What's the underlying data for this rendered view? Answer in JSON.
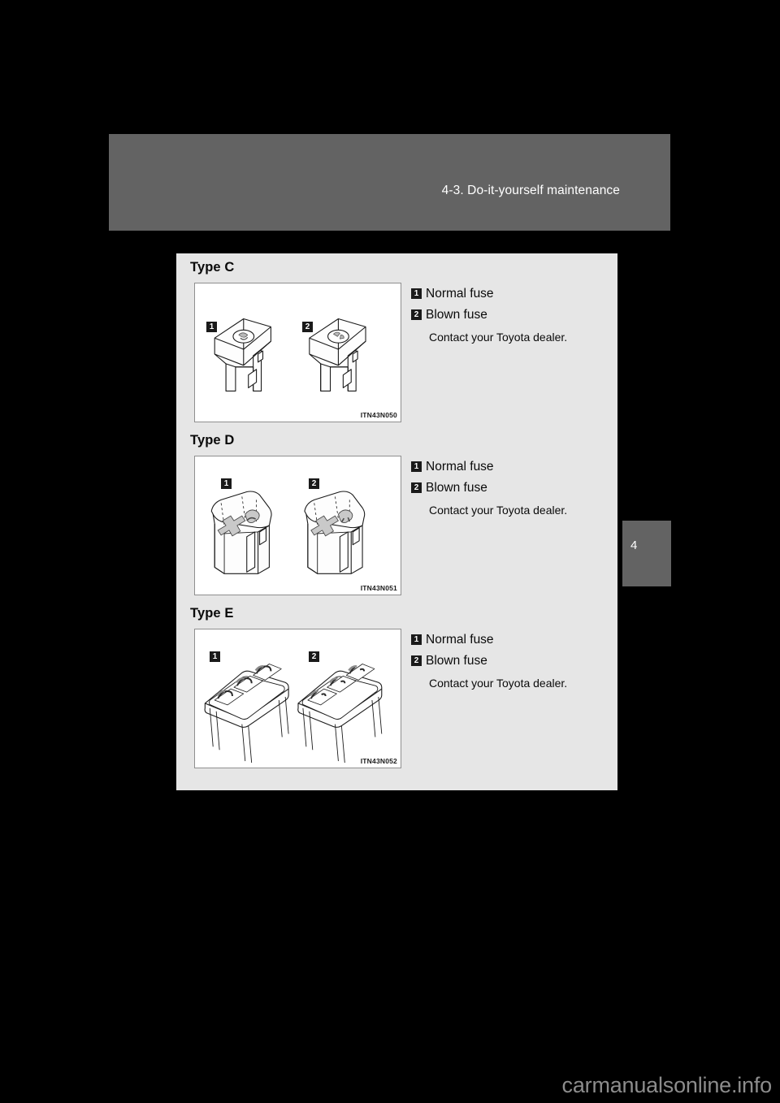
{
  "page": {
    "header_title": "4-3. Do-it-yourself maintenance",
    "chapter_tab_number": "4",
    "watermark": "carmanualsonline.info",
    "colors": {
      "background": "#000000",
      "header_band": "#636363",
      "panel": "#e6e6e6",
      "figure_bg": "#ffffff",
      "marker": "#1a1a1a",
      "text": "#0a0a0a"
    }
  },
  "sections": [
    {
      "heading": "Type C",
      "figure_code": "ITN43N050",
      "figure_marker_1": "1",
      "figure_marker_2": "2",
      "callouts": [
        {
          "marker": "1",
          "label": "Normal fuse"
        },
        {
          "marker": "2",
          "label": "Blown fuse"
        }
      ],
      "note": "Contact your Toyota dealer."
    },
    {
      "heading": "Type D",
      "figure_code": "ITN43N051",
      "figure_marker_1": "1",
      "figure_marker_2": "2",
      "callouts": [
        {
          "marker": "1",
          "label": "Normal fuse"
        },
        {
          "marker": "2",
          "label": "Blown fuse"
        }
      ],
      "note": "Contact your Toyota dealer."
    },
    {
      "heading": "Type E",
      "figure_code": "ITN43N052",
      "figure_marker_1": "1",
      "figure_marker_2": "2",
      "callouts": [
        {
          "marker": "1",
          "label": "Normal fuse"
        },
        {
          "marker": "2",
          "label": "Blown fuse"
        }
      ],
      "note": "Contact your Toyota dealer."
    }
  ]
}
